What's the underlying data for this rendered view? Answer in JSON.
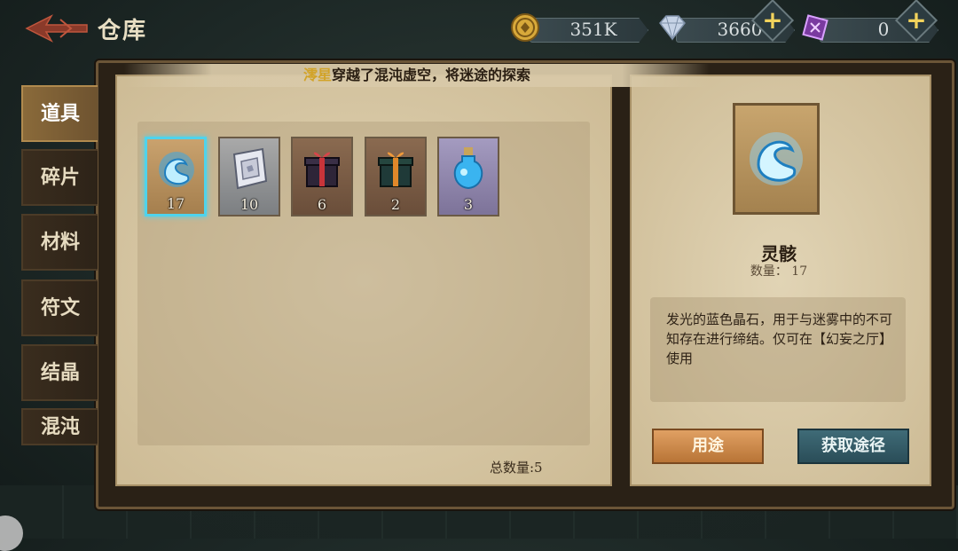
{
  "header": {
    "title": "仓库"
  },
  "currency": [
    {
      "name": "gold-coin-icon",
      "value": "351K"
    },
    {
      "name": "diamond-icon",
      "value": "3660"
    },
    {
      "name": "purple-crystal-icon",
      "value": "0"
    }
  ],
  "plus_label": "+",
  "ticker": {
    "highlight": "澪星",
    "text": "穿越了混沌虚空，将迷途的探索"
  },
  "tabs": [
    {
      "label": "道具",
      "active": true
    },
    {
      "label": "碎片",
      "active": false
    },
    {
      "label": "材料",
      "active": false
    },
    {
      "label": "符文",
      "active": false
    },
    {
      "label": "结晶",
      "active": false
    },
    {
      "label": "混沌",
      "active": false
    }
  ],
  "items": [
    {
      "icon": "blue-spirit-orb-icon",
      "count": "17",
      "selected": true
    },
    {
      "icon": "silver-book-icon",
      "count": "10",
      "selected": false
    },
    {
      "icon": "red-gift-box-icon",
      "count": "6",
      "selected": false
    },
    {
      "icon": "green-gift-box-icon",
      "count": "2",
      "selected": false
    },
    {
      "icon": "blue-potion-icon",
      "count": "3",
      "selected": false
    }
  ],
  "total": "总数量:5",
  "detail": {
    "name": "灵骸",
    "quantity": "数量： 17",
    "description": "发光的蓝色晶石，用于与迷雾中的不可知存在进行缔结。仅可在【幻妄之厅】使用",
    "use_button": "用途",
    "source_button": "获取途径"
  },
  "colors": {
    "selected_border": "#4fd3ec",
    "gold_text": "#d2a328",
    "use_button": "#c9854a",
    "source_button": "#356070"
  }
}
